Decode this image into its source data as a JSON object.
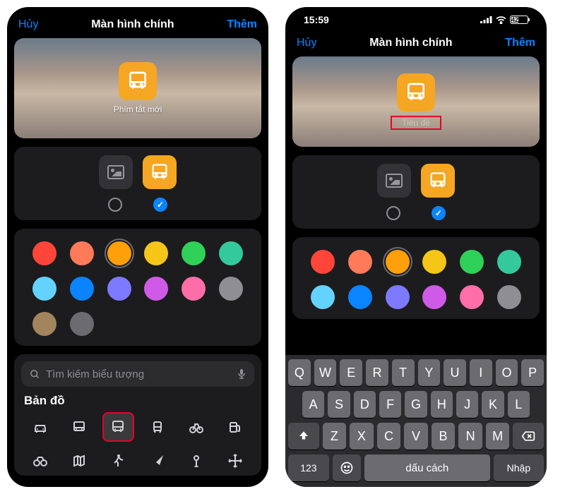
{
  "left": {
    "nav": {
      "cancel": "Hủy",
      "title": "Màn hình chính",
      "done": "Thêm"
    },
    "preview": {
      "label": "Phím tắt mới"
    },
    "search": {
      "placeholder": "Tìm kiếm biểu tượng"
    },
    "section": {
      "maps": "Bản đồ"
    }
  },
  "right": {
    "status": {
      "time": "15:59",
      "battery": "42"
    },
    "nav": {
      "cancel": "Hủy",
      "title": "Màn hình chính",
      "done": "Thêm"
    },
    "preview": {
      "placeholder": "Tiêu đề"
    },
    "keyboard": {
      "row1": [
        "Q",
        "W",
        "E",
        "R",
        "T",
        "Y",
        "U",
        "I",
        "O",
        "P"
      ],
      "row2": [
        "A",
        "S",
        "D",
        "F",
        "G",
        "H",
        "J",
        "K",
        "L"
      ],
      "row3": [
        "Z",
        "X",
        "C",
        "V",
        "B",
        "N",
        "M"
      ],
      "num": "123",
      "space": "dấu cách",
      "enter": "Nhập"
    }
  },
  "colors": {
    "row": [
      "#ff453a",
      "#ff7a59",
      "#ff9f0a",
      "#f5c518",
      "#30d158",
      "#34c99a",
      "#64d2ff",
      "#0a84ff",
      "#7d7aff",
      "#cf5ae8",
      "#ff6ea9",
      "#8e8e93",
      "#a2845e",
      "#6c6c70"
    ]
  },
  "map_icons": [
    "car",
    "bus",
    "truck",
    "tram",
    "bike",
    "fuel",
    "binoculars",
    "map",
    "walk",
    "arrow",
    "pin",
    "move"
  ],
  "accent": "#f5a623"
}
